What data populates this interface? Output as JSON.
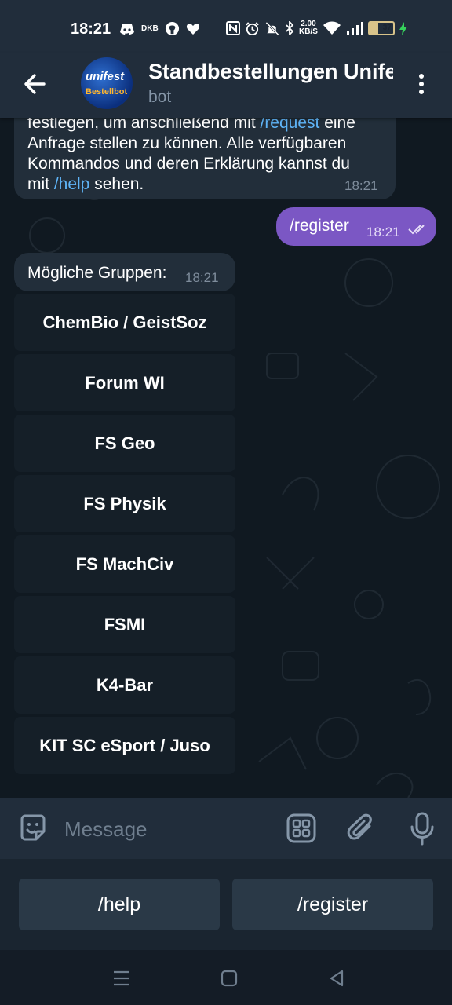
{
  "status_bar": {
    "time": "18:21",
    "left_icons": [
      "discord-icon",
      "dkb-icon",
      "github-icon",
      "heart-icon"
    ],
    "dkb_label": "DKB",
    "net_speed_value": "2.00",
    "net_speed_unit": "KB/S",
    "battery_level": "37",
    "battery_fraction": 0.37
  },
  "header": {
    "title": "Standbestellungen Unifest",
    "subtitle": "bot",
    "avatar_line1": "unifest",
    "avatar_line2": "Bestellbot"
  },
  "messages": {
    "first": {
      "line1_prefix": "festlegen, um anschließend mit ",
      "line1_cmd": "/request",
      "line1_suffix": " eine",
      "line2": "Anfrage stellen zu können. Alle verfügbaren",
      "line3": "Kommandos und deren Erklärung kannst du",
      "line4_prefix": "mit ",
      "line4_cmd": "/help",
      "line4_suffix": " sehen.",
      "time": "18:21"
    },
    "outgoing": {
      "text": "/register",
      "time": "18:21"
    },
    "groups": {
      "text": "Mögliche Gruppen:",
      "time": "18:21"
    }
  },
  "inline_buttons": [
    "ChemBio / GeistSoz",
    "Forum WI",
    "FS Geo",
    "FS Physik",
    "FS MachCiv",
    "FSMI",
    "K4-Bar",
    "KIT SC eSport / Juso"
  ],
  "composer": {
    "placeholder": "Message"
  },
  "reply_keyboard": {
    "help": "/help",
    "register": "/register"
  },
  "colors": {
    "header_bg": "#212d3b",
    "incoming_bubble": "#222e3a",
    "outgoing_bubble": "#7b57c4",
    "link": "#5fb4f7"
  }
}
